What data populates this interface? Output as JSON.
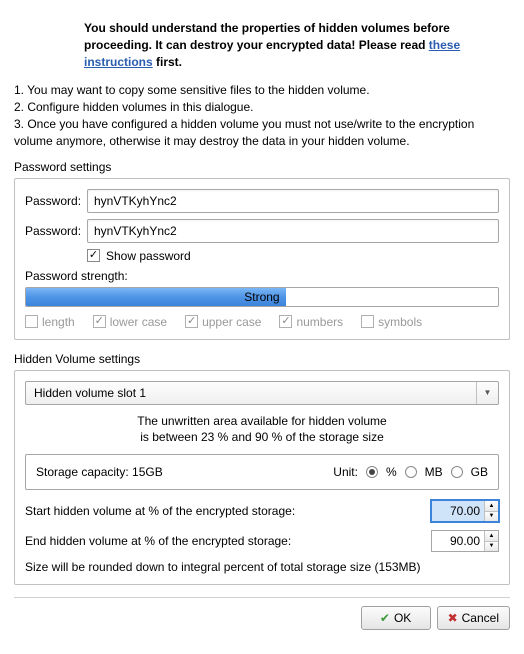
{
  "intro": {
    "line1": "You should understand the properties of hidden volumes before proceeding. It can destroy your encrypted data! Please read ",
    "link": "these instructions",
    "line2": " first."
  },
  "instructions": {
    "i1": "1. You may want to copy some sensitive files to the hidden volume.",
    "i2": "2. Configure hidden volumes in this dialogue.",
    "i3": "3. Once you have configured a hidden volume you must not use/write to the encryption volume anymore, otherwise it may destroy the data in your hidden volume."
  },
  "password_section_label": "Password settings",
  "password": {
    "label1": "Password:",
    "label2": "Password:",
    "value": "hynVTKyhYnc2",
    "show_label": "Show password",
    "strength_label": "Password strength:",
    "strength_text": "Strong",
    "strength_percent": 55,
    "criteria": {
      "length": "length",
      "lower": "lower case",
      "upper": "upper case",
      "numbers": "numbers",
      "symbols": "symbols"
    }
  },
  "hidden_section_label": "Hidden Volume settings",
  "hidden": {
    "slot_label": "Hidden volume slot 1",
    "info_line1": "The unwritten area available for hidden volume",
    "info_line2": "is between 23 % and 90 % of the storage size",
    "storage_label": "Storage capacity: 15GB",
    "unit_label": "Unit:",
    "unit_percent": "%",
    "unit_mb": "MB",
    "unit_gb": "GB",
    "start_label": "Start hidden volume at % of the encrypted storage:",
    "start_value": "70.00",
    "end_label": "End hidden volume at % of the encrypted storage:",
    "end_value": "90.00",
    "note": "Size will be rounded down to integral percent of total storage size (153MB)"
  },
  "footer": {
    "ok": "OK",
    "cancel": "Cancel"
  }
}
